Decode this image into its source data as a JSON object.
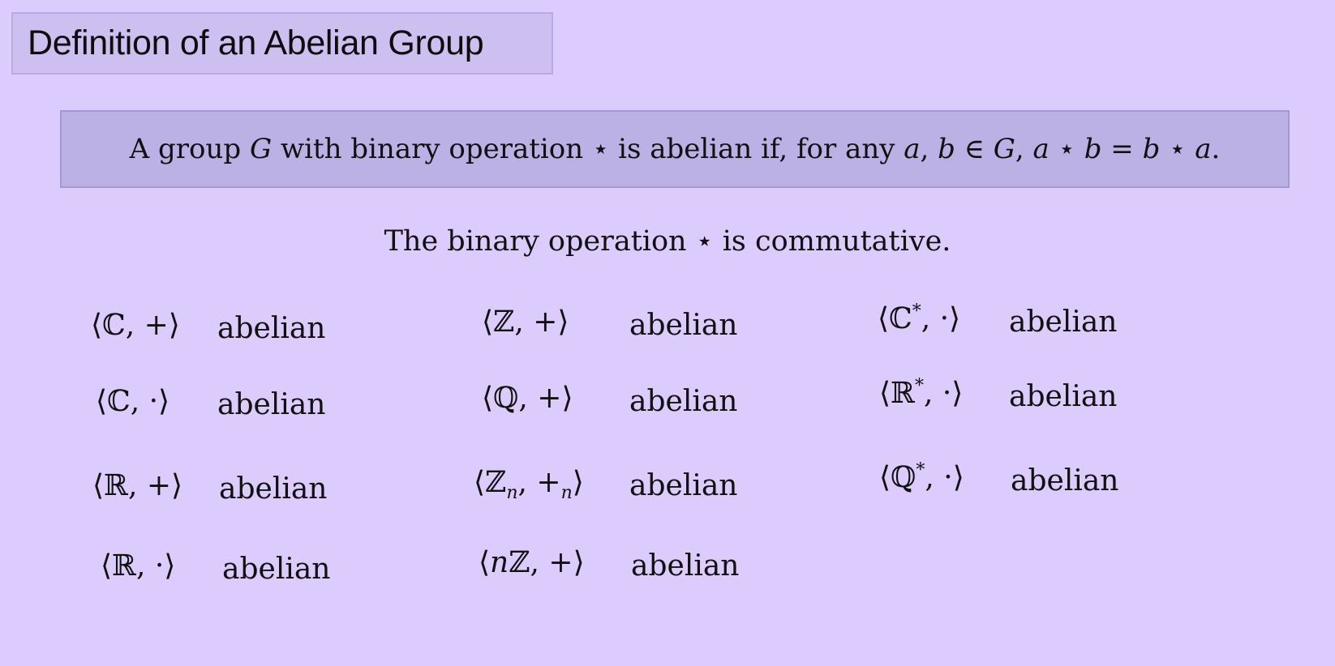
{
  "slide": {
    "title": "Definition of an Abelian Group",
    "definition": {
      "p1": "A group ",
      "G1": "G",
      "p2": " with binary operation ",
      "star1": "⋆",
      "p3": " is abelian if, for any ",
      "a1": "a",
      "comma": ", ",
      "b1": "b",
      "in": " ∈ ",
      "G2": "G",
      "p4": ", ",
      "a2": "a",
      "star2": " ⋆ ",
      "b2": "b",
      "eq": " = ",
      "b3": "b",
      "star3": " ⋆ ",
      "a3": "a",
      "end": "."
    },
    "statement": "The binary operation ⋆ is commutative."
  },
  "groups": [
    {
      "id": "c-add",
      "pre": "⟨ℂ, +⟩",
      "sup": "",
      "sub": "",
      "post": "",
      "label": "abelian"
    },
    {
      "id": "c-mul",
      "pre": "⟨ℂ, ·⟩",
      "sup": "",
      "sub": "",
      "post": "",
      "label": "abelian"
    },
    {
      "id": "r-add",
      "pre": "⟨ℝ, +⟩",
      "sup": "",
      "sub": "",
      "post": "",
      "label": "abelian"
    },
    {
      "id": "r-mul",
      "pre": "⟨ℝ, ·⟩",
      "sup": "",
      "sub": "",
      "post": "",
      "label": "abelian"
    },
    {
      "id": "z-add",
      "pre": "⟨ℤ, +⟩",
      "sup": "",
      "sub": "",
      "post": "",
      "label": "abelian"
    },
    {
      "id": "q-add",
      "pre": "⟨ℚ, +⟩",
      "sup": "",
      "sub": "",
      "post": "",
      "label": "abelian"
    },
    {
      "id": "zn-add",
      "pre": "⟨ℤ",
      "sub": "n",
      "mid": ", +",
      "sub2": "n",
      "post": "⟩",
      "label": "abelian"
    },
    {
      "id": "nz-add",
      "pre": "⟨",
      "it": "n",
      "rest": "ℤ, +⟩",
      "label": "abelian"
    },
    {
      "id": "cs-mul",
      "pre": "⟨ℂ",
      "sup": "*",
      "post": ", ·⟩",
      "label": "abelian"
    },
    {
      "id": "rs-mul",
      "pre": "⟨ℝ",
      "sup": "*",
      "post": ", ·⟩",
      "label": "abelian"
    },
    {
      "id": "qs-mul",
      "pre": "⟨ℚ",
      "sup": "*",
      "post": ", ·⟩",
      "label": "abelian"
    }
  ]
}
